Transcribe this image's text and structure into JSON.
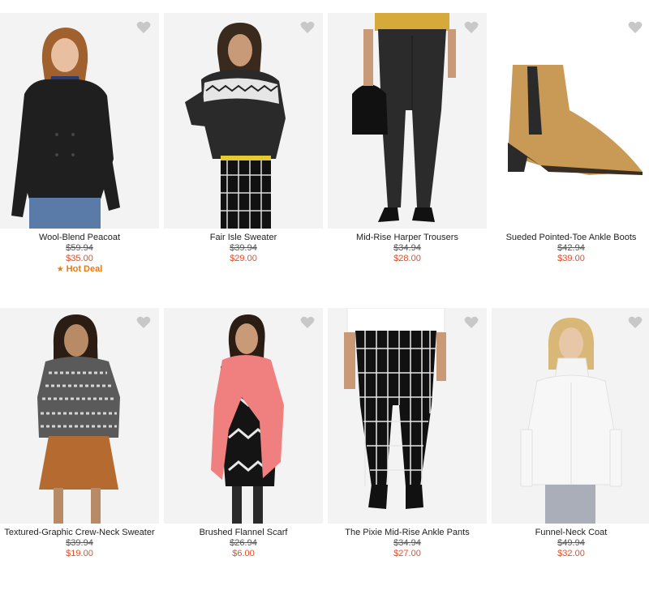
{
  "colors": {
    "sale_price": "#ea4b23",
    "hot_deal": "#ea7a10",
    "heart": "#c8c8c8"
  },
  "products": [
    {
      "name": "Wool-Blend Peacoat",
      "old_price": "$59.94",
      "price": "$35.00",
      "badge": "Hot Deal",
      "badge_icon": "star-icon"
    },
    {
      "name": "Fair Isle Sweater",
      "old_price": "$39.94",
      "price": "$29.00"
    },
    {
      "name": "Mid-Rise Harper Trousers",
      "old_price": "$34.94",
      "price": "$28.00"
    },
    {
      "name": "Sueded Pointed-Toe Ankle Boots",
      "old_price": "$42.94",
      "price": "$39.00"
    },
    {
      "name": "Textured-Graphic Crew-Neck Sweater",
      "old_price": "$39.94",
      "price": "$19.00"
    },
    {
      "name": "Brushed Flannel Scarf",
      "old_price": "$26.94",
      "price": "$6.00"
    },
    {
      "name": "The Pixie Mid-Rise Ankle Pants",
      "old_price": "$34.94",
      "price": "$27.00"
    },
    {
      "name": "Funnel-Neck Coat",
      "old_price": "$49.94",
      "price": "$32.00"
    }
  ]
}
